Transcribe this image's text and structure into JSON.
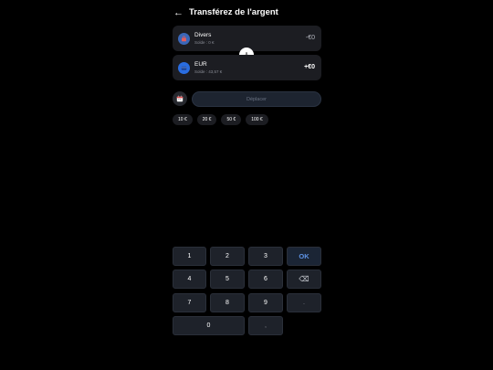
{
  "header": {
    "back_icon": "←",
    "title": "Transférez de l'argent"
  },
  "from_account": {
    "icon": "bag-icon",
    "name": "Divers",
    "balance": "Solde : 0 €",
    "amount": "-€0"
  },
  "to_account": {
    "icon": "card-icon",
    "name": "EUR",
    "balance": "Solde : 43,57 €",
    "amount": "+€0"
  },
  "swap_icon": "arrow-down-icon",
  "date_icon": "calendar-icon",
  "move_button_label": "Déplacer",
  "quick_amounts": [
    "10 €",
    "20 €",
    "50 €",
    "100 €"
  ],
  "keypad": {
    "row1": [
      "1",
      "2",
      "3"
    ],
    "ok": "OK",
    "row2": [
      "4",
      "5",
      "6"
    ],
    "backspace": "⌫",
    "row3": [
      "7",
      "8",
      "9"
    ],
    "dot_right": ".",
    "zero": "0",
    "dot_bottom": ","
  },
  "colors": {
    "background": "#000000",
    "card": "#1c1d22",
    "key": "#1e222a",
    "accent": "#5e93e6"
  }
}
